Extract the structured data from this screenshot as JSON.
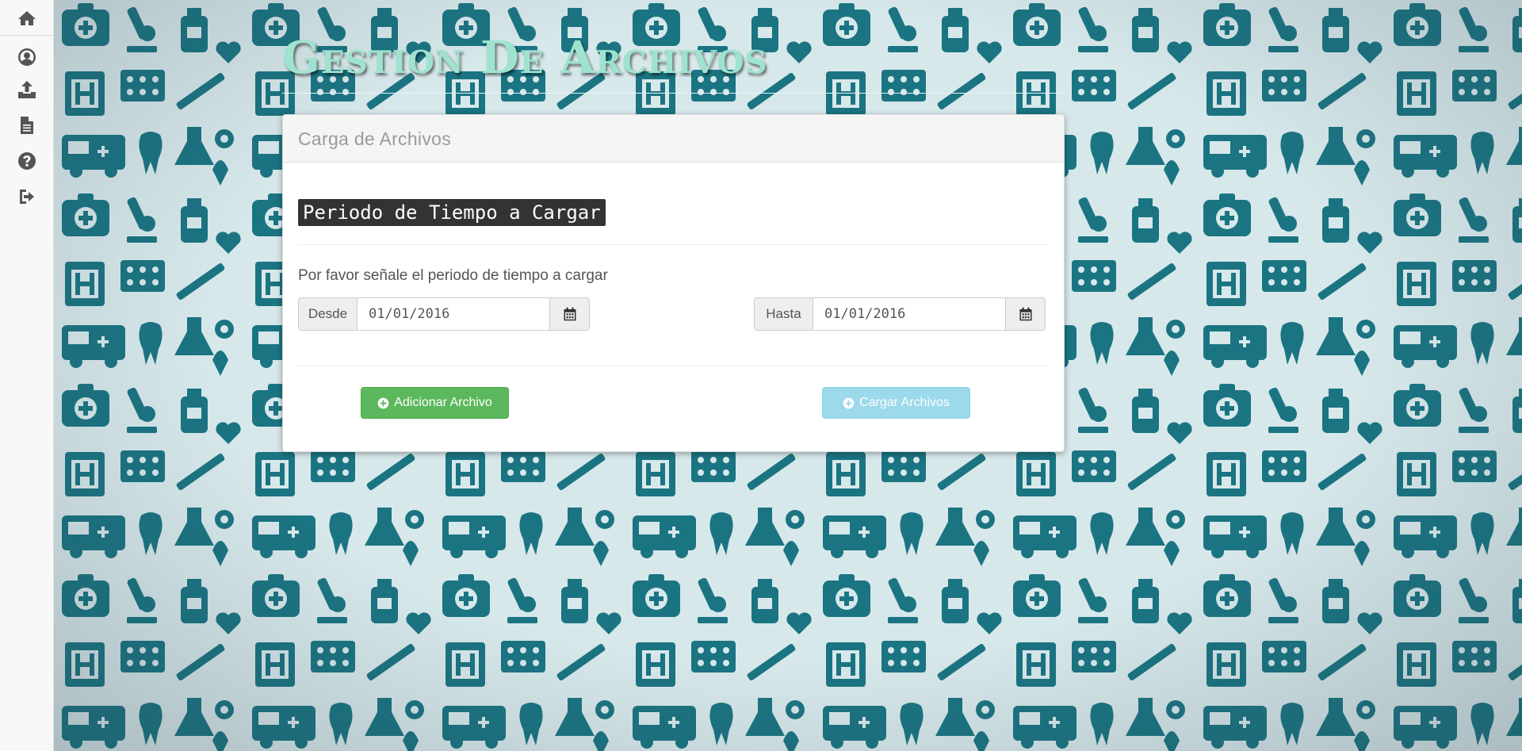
{
  "sidebar": {
    "items": [
      {
        "name": "home",
        "icon": "home-icon"
      },
      {
        "name": "profile",
        "icon": "user-circle-icon"
      },
      {
        "name": "upload",
        "icon": "upload-icon"
      },
      {
        "name": "documents",
        "icon": "file-text-icon"
      },
      {
        "name": "help",
        "icon": "question-circle-icon"
      },
      {
        "name": "logout",
        "icon": "sign-out-icon"
      }
    ]
  },
  "header": {
    "title": "Gestion De Archivos"
  },
  "panel": {
    "heading": "Carga de Archivos",
    "section_title": "Periodo de Tiempo a Cargar",
    "instructions": "Por favor señale el periodo de tiempo a cargar",
    "from": {
      "label": "Desde",
      "value": "01/01/2016",
      "icon": "calendar-icon"
    },
    "to": {
      "label": "Hasta",
      "value": "01/01/2016",
      "icon": "calendar-icon"
    },
    "add_button": {
      "label": "Adicionar Archivo",
      "icon": "plus-circle-icon",
      "color": "#5cb85c"
    },
    "upload_button": {
      "label": "Cargar Archivos",
      "icon": "plus-circle-icon",
      "color": "#5bc0de",
      "state": "disabled"
    }
  },
  "colors": {
    "title": "#9ee3cf",
    "background_pattern": "#1b7482"
  }
}
